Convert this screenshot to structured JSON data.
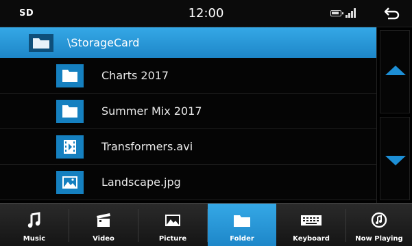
{
  "status": {
    "source": "SD",
    "time": "12:00"
  },
  "path": "\\StorageCard",
  "items": [
    {
      "label": "Charts 2017",
      "icon": "folder-icon"
    },
    {
      "label": "Summer Mix 2017",
      "icon": "folder-icon"
    },
    {
      "label": "Transformers.avi",
      "icon": "video-file-icon"
    },
    {
      "label": "Landscape.jpg",
      "icon": "image-file-icon"
    }
  ],
  "tabs": [
    {
      "label": "Music",
      "icon": "music-note-icon",
      "active": false
    },
    {
      "label": "Video",
      "icon": "clapperboard-icon",
      "active": false
    },
    {
      "label": "Picture",
      "icon": "picture-icon",
      "active": false
    },
    {
      "label": "Folder",
      "icon": "folder-icon",
      "active": true
    },
    {
      "label": "Keyboard",
      "icon": "keyboard-icon",
      "active": false
    },
    {
      "label": "Now Playing",
      "icon": "now-playing-icon",
      "active": false
    }
  ],
  "colors": {
    "accent": "#1d8fd6",
    "active_tab": "#2a9ae0",
    "background": "#000000"
  }
}
